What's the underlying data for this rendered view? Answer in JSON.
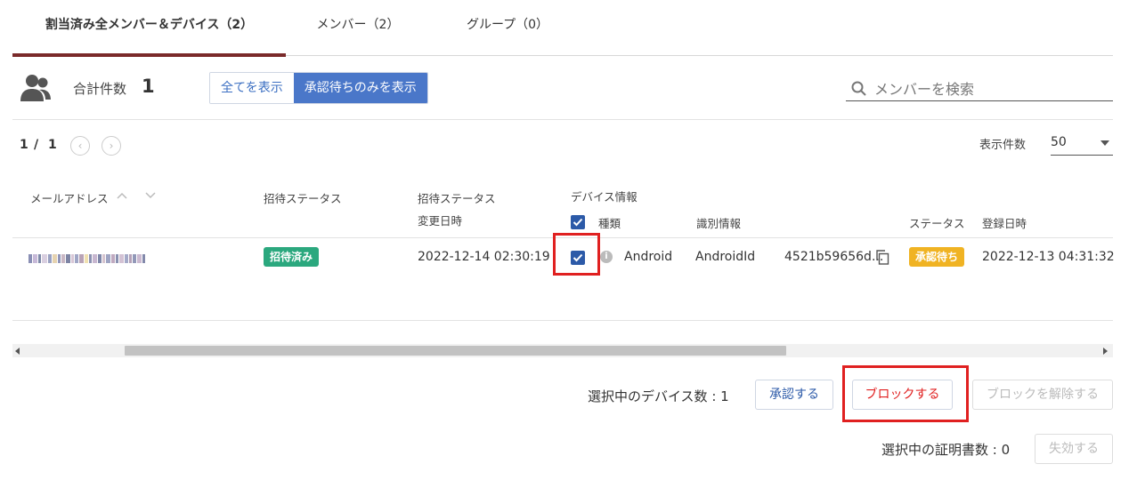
{
  "tabs": [
    {
      "label": "割当済み全メンバー＆デバイス（2）"
    },
    {
      "label": "メンバー（2）"
    },
    {
      "label": "グループ（0）"
    }
  ],
  "summary": {
    "label": "合計件数",
    "count": "1"
  },
  "filter": {
    "all_label": "全てを表示",
    "pending_label": "承認待ちのみを表示"
  },
  "search": {
    "placeholder": "メンバーを検索"
  },
  "pagination": {
    "current": "1",
    "separator": "/",
    "total": "1"
  },
  "page_size": {
    "label": "表示件数",
    "value": "50"
  },
  "table": {
    "headers": {
      "email": "メールアドレス",
      "invite_status": "招待ステータス",
      "invite_status_changed_line1": "招待ステータス",
      "invite_status_changed_line2": "変更日時",
      "device_info": "デバイス情報",
      "device_type": "種類",
      "device_id_info": "識別情報",
      "device_status": "ステータス",
      "registered_at": "登録日時"
    },
    "rows": [
      {
        "invite_status": "招待済み",
        "invite_changed_at": "2022-12-14 02:30:19",
        "device_type": "Android",
        "id_type": "AndroidId",
        "id_value": "4521b59656d...",
        "device_status": "承認待ち",
        "registered_at": "2022-12-13 04:31:32"
      }
    ]
  },
  "actions": {
    "selected_devices_label": "選択中のデバイス数 : 1",
    "approve": "承認する",
    "block": "ブロックする",
    "unblock": "ブロックを解除する",
    "selected_certs_label": "選択中の証明書数 : 0",
    "revoke": "失効する"
  },
  "colors": {
    "accent": "#4a77c9",
    "tab_underline": "#7a2a2a",
    "invited_badge": "#2ba87e",
    "pending_badge": "#f0b323",
    "highlight": "#e02020"
  }
}
